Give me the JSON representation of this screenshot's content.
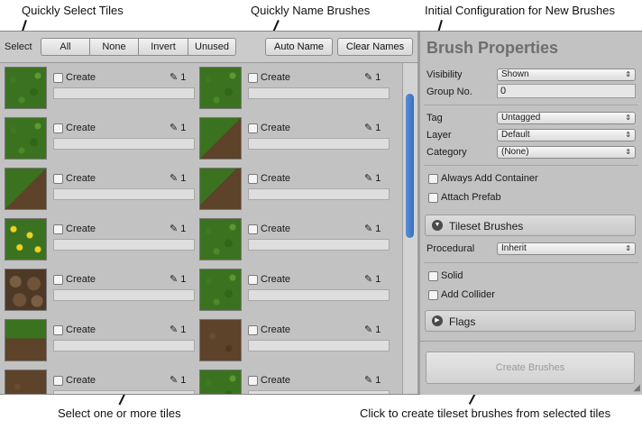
{
  "callouts": {
    "select_tiles": "Quickly Select Tiles",
    "name_brushes": "Quickly Name Brushes",
    "initial_config": "Initial Configuration for New Brushes",
    "select_one": "Select one or more tiles",
    "click_create": "Click to create tileset brushes from selected tiles"
  },
  "toolbar": {
    "select_label": "Select",
    "buttons": [
      "All",
      "None",
      "Invert",
      "Unused"
    ],
    "auto_name": "Auto Name",
    "clear_names": "Clear Names"
  },
  "tiles": {
    "checkbox_label": "Create",
    "count": "1",
    "left": [
      "grass",
      "grass",
      "dirt-tl",
      "flowers",
      "stones",
      "grass-bottom",
      "dirt"
    ],
    "right": [
      "grass",
      "dirt-tl",
      "dirt-br",
      "grass",
      "grass",
      "dirt",
      "grass"
    ]
  },
  "props": {
    "title": "Brush Properties",
    "visibility_label": "Visibility",
    "visibility_value": "Shown",
    "group_label": "Group No.",
    "group_value": "0",
    "tag_label": "Tag",
    "tag_value": "Untagged",
    "layer_label": "Layer",
    "layer_value": "Default",
    "category_label": "Category",
    "category_value": "(None)",
    "always_add_container": "Always Add Container",
    "attach_prefab": "Attach Prefab",
    "tileset_brushes": "Tileset Brushes",
    "procedural_label": "Procedural",
    "procedural_value": "Inherit",
    "solid": "Solid",
    "add_collider": "Add Collider",
    "flags": "Flags",
    "create_brushes": "Create Brushes"
  }
}
